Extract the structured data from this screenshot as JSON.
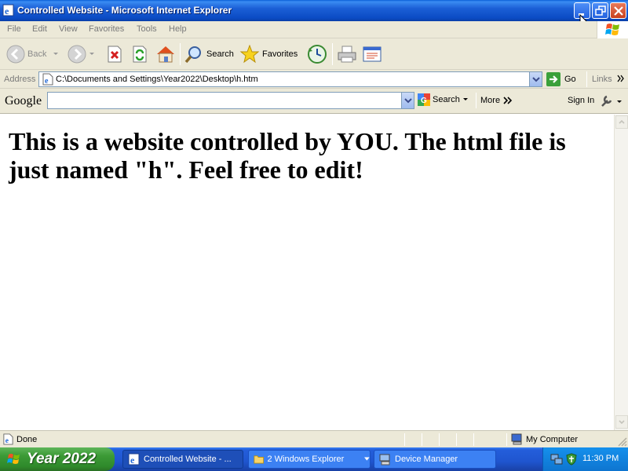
{
  "window": {
    "title": "Controlled Website - Microsoft Internet Explorer"
  },
  "menubar": {
    "items": [
      "File",
      "Edit",
      "View",
      "Favorites",
      "Tools",
      "Help"
    ]
  },
  "toolbar": {
    "back_label": "Back",
    "search_label": "Search",
    "favorites_label": "Favorites"
  },
  "address": {
    "label": "Address",
    "value": "C:\\Documents and Settings\\Year2022\\Desktop\\h.htm",
    "go_label": "Go",
    "links_label": "Links"
  },
  "google": {
    "logo": "Google",
    "search_label": "Search",
    "more_label": "More",
    "signin_label": "Sign In"
  },
  "page": {
    "heading": "This is a website controlled by YOU. The html file is just named \"h\". Feel free to edit!"
  },
  "status": {
    "text": "Done",
    "zone": "My Computer"
  },
  "taskbar": {
    "start_label": "Year 2022",
    "tasks": [
      "Controlled Website - ...",
      "2 Windows Explorer",
      "Device Manager"
    ],
    "clock": "11:30 PM"
  }
}
